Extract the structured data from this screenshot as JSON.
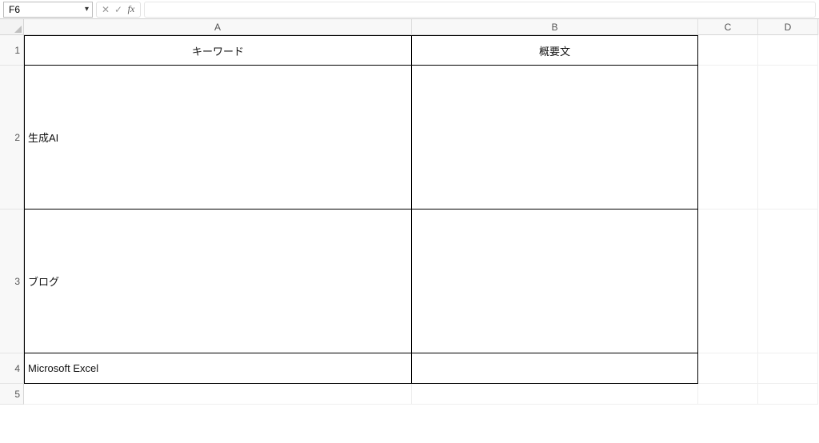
{
  "nameBox": "F6",
  "fx": {
    "cancel": "✕",
    "enter": "✓",
    "label": "fx"
  },
  "formulaValue": "",
  "columns": [
    "A",
    "B",
    "C",
    "D"
  ],
  "rowNumbers": [
    "1",
    "2",
    "3",
    "4",
    "5"
  ],
  "table": {
    "headers": {
      "A": "キーワード",
      "B": "概要文"
    },
    "rows": [
      {
        "A": "生成AI",
        "B": ""
      },
      {
        "A": "ブログ",
        "B": ""
      },
      {
        "A": "Microsoft Excel",
        "B": ""
      }
    ]
  }
}
